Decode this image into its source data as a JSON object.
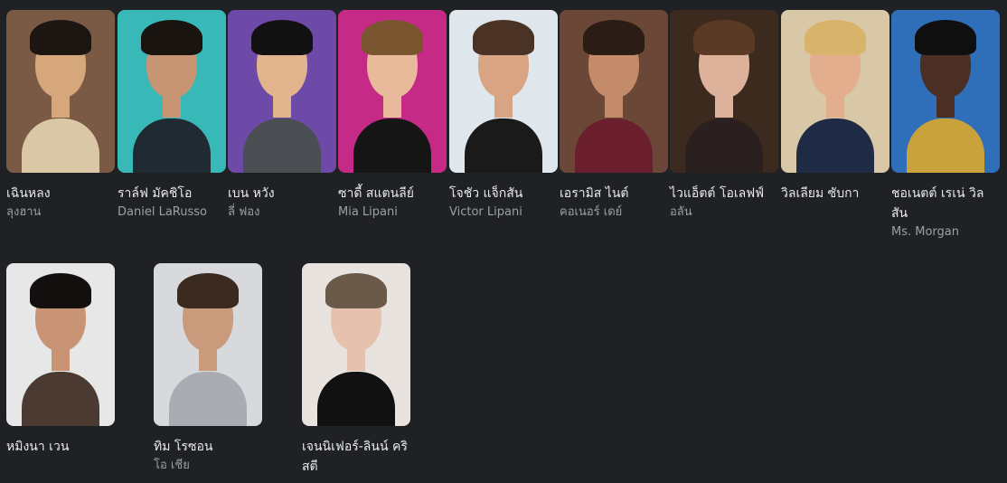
{
  "cast": [
    {
      "name": "เฉินหลง",
      "role": "ลุงฮาน",
      "colors": {
        "bg": "#7a5a45",
        "hair": "#1d1512",
        "skin": "#d7a77c",
        "body": "#d9c7a6"
      }
    },
    {
      "name": "ราล์ฟ มัคชิโอ",
      "role": "Daniel LaRusso",
      "colors": {
        "bg": "#38b8b6",
        "hair": "#1a1410",
        "skin": "#c79474",
        "body": "#1f2a33"
      }
    },
    {
      "name": "เบน หวัง",
      "role": "ลี่ ฟอง",
      "colors": {
        "bg": "#6d4aa8",
        "hair": "#121111",
        "skin": "#e2b48e",
        "body": "#4b4e53"
      }
    },
    {
      "name": "ซาดี้ สแตนลีย์",
      "role": "Mia Lipani",
      "colors": {
        "bg": "#c42a86",
        "hair": "#7a5630",
        "skin": "#e8b99a",
        "body": "#151515"
      }
    },
    {
      "name": "โจชัว แจ็กสัน",
      "role": "Victor Lipani",
      "colors": {
        "bg": "#dfe6ec",
        "hair": "#4a3324",
        "skin": "#d9a483",
        "body": "#1a1a1a"
      }
    },
    {
      "name": "เอรามิส ไนต์",
      "role": "คอเนอร์ เดย์",
      "colors": {
        "bg": "#6a4737",
        "hair": "#2b1d15",
        "skin": "#c48b6a",
        "body": "#6b1f2e"
      }
    },
    {
      "name": "ไวแอ็ตต์ โอเลฟฟ์",
      "role": "อลัน",
      "colors": {
        "bg": "#3d2a1f",
        "hair": "#5a3a24",
        "skin": "#ddb29b",
        "body": "#2b2020"
      }
    },
    {
      "name": "วิลเลียม ซับกา",
      "role": "",
      "colors": {
        "bg": "#d9c8a8",
        "hair": "#d7b36c",
        "skin": "#e3ae8d",
        "body": "#1f2a44"
      }
    },
    {
      "name": "ชอเนตต์ เรเน่ วิลสัน",
      "role": "Ms. Morgan",
      "colors": {
        "bg": "#2f6fba",
        "hair": "#0f0f0f",
        "skin": "#4b2f24",
        "body": "#c9a23c"
      }
    },
    {
      "name": "หมิงนา เวน",
      "role": "",
      "colors": {
        "bg": "#e7e7e7",
        "hair": "#120f0e",
        "skin": "#c99475",
        "body": "#4a3a32"
      }
    },
    {
      "name": "ทิม โรซอน",
      "role": "โอ เชีย",
      "colors": {
        "bg": "#d7d9dd",
        "hair": "#3a2a20",
        "skin": "#c99a7b",
        "body": "#a9adb3"
      }
    },
    {
      "name": "เจนนิเฟอร์-ลินน์ คริสตี",
      "role": "",
      "colors": {
        "bg": "#e8e3df",
        "hair": "#6b5a49",
        "skin": "#e6c1ad",
        "body": "#111111"
      }
    }
  ]
}
